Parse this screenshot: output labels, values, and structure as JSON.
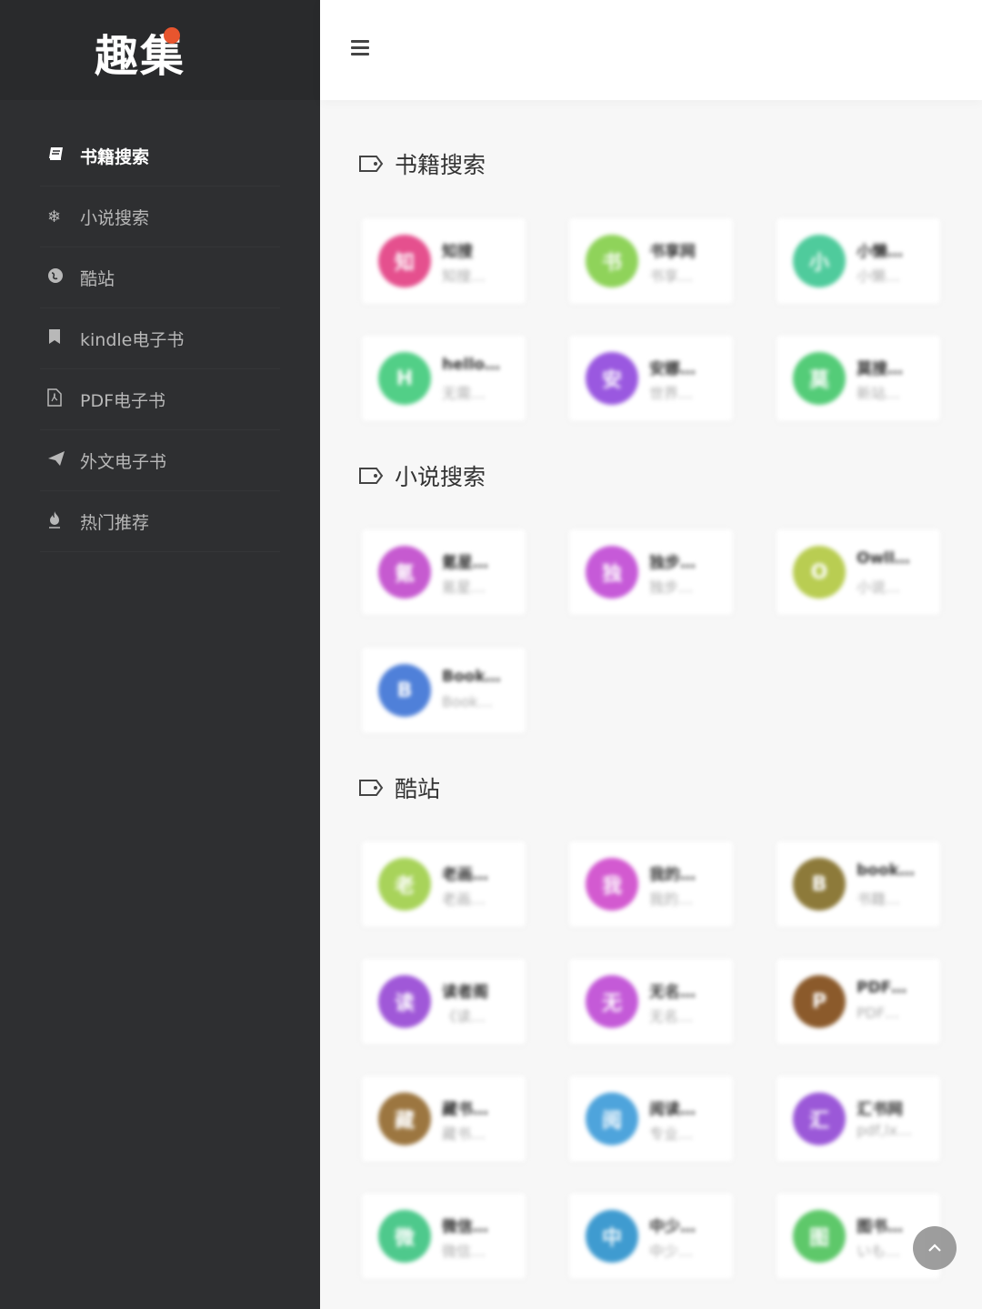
{
  "app": {
    "logo": "趣集",
    "accent": "#e8552e"
  },
  "sidebar": {
    "items": [
      {
        "label": "书籍搜索",
        "icon": "book-icon",
        "active": true
      },
      {
        "label": "小说搜索",
        "icon": "snowflake-icon"
      },
      {
        "label": "酷站",
        "icon": "globe-icon"
      },
      {
        "label": "kindle电子书",
        "icon": "bookmark-icon"
      },
      {
        "label": "PDF电子书",
        "icon": "pdf-file-icon"
      },
      {
        "label": "外文电子书",
        "icon": "paper-plane-icon"
      },
      {
        "label": "热门推荐",
        "icon": "fire-icon"
      }
    ]
  },
  "sections": [
    {
      "title": "书籍搜索",
      "cards": [
        {
          "avatar": "知",
          "name": "知搜",
          "desc": "知搜…",
          "color": "#e5508e"
        },
        {
          "avatar": "书",
          "name": "书享网",
          "desc": "书享…",
          "color": "#8fd35a"
        },
        {
          "avatar": "小",
          "name": "小懒…",
          "desc": "小懒…",
          "color": "#4fcb9c"
        },
        {
          "avatar": "H",
          "name": "hello…",
          "desc": "无需…",
          "color": "#52cf87"
        },
        {
          "avatar": "安",
          "name": "安娜…",
          "desc": "世界…",
          "color": "#9a58e0"
        },
        {
          "avatar": "莫",
          "name": "莫搜…",
          "desc": "新站…",
          "color": "#54cc78"
        }
      ]
    },
    {
      "title": "小说搜索",
      "cards": [
        {
          "avatar": "氪",
          "name": "氪星…",
          "desc": "氪星…",
          "color": "#c65ad0"
        },
        {
          "avatar": "独",
          "name": "独步…",
          "desc": "独步…",
          "color": "#c65ad8"
        },
        {
          "avatar": "O",
          "name": "Owll…",
          "desc": "小说…",
          "color": "#b9cd52"
        },
        {
          "avatar": "B",
          "name": "Book…",
          "desc": "Book…",
          "color": "#4f80d9"
        }
      ]
    },
    {
      "title": "酷站",
      "cards": [
        {
          "avatar": "老",
          "name": "老画…",
          "desc": "老画…",
          "color": "#a8d35a"
        },
        {
          "avatar": "我",
          "name": "我的…",
          "desc": "我的…",
          "color": "#d35ad0"
        },
        {
          "avatar": "B",
          "name": "book…",
          "desc": "书籍…",
          "color": "#8d7a3a"
        },
        {
          "avatar": "读",
          "name": "读者阁",
          "desc": "《读…",
          "color": "#a058d8"
        },
        {
          "avatar": "无",
          "name": "无名…",
          "desc": "无名…",
          "color": "#c45ad8"
        },
        {
          "avatar": "P",
          "name": "PDF…",
          "desc": "PDF…",
          "color": "#8b5a2b"
        },
        {
          "avatar": "藏",
          "name": "藏书…",
          "desc": "藏书…",
          "color": "#9c7640"
        },
        {
          "avatar": "阅",
          "name": "阅读…",
          "desc": "专业…",
          "color": "#4ea4dc"
        },
        {
          "avatar": "汇",
          "name": "汇书网",
          "desc": "pdf,lx…",
          "color": "#9b58d8"
        },
        {
          "avatar": "微",
          "name": "微信…",
          "desc": "微信…",
          "color": "#4ec98c"
        },
        {
          "avatar": "中",
          "name": "中少…",
          "desc": "中少…",
          "color": "#3f9bd0"
        },
        {
          "avatar": "图",
          "name": "图书…",
          "desc": "いも…",
          "color": "#5ec86a"
        }
      ]
    }
  ]
}
